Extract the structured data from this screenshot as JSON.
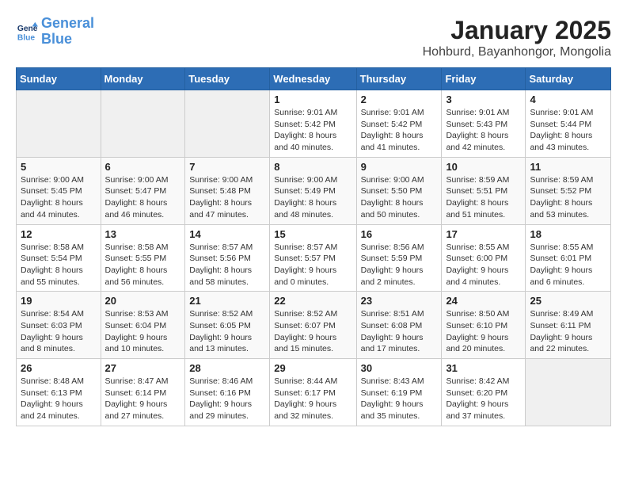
{
  "logo": {
    "line1": "General",
    "line2": "Blue"
  },
  "title": "January 2025",
  "location": "Hohburd, Bayanhongor, Mongolia",
  "days_of_week": [
    "Sunday",
    "Monday",
    "Tuesday",
    "Wednesday",
    "Thursday",
    "Friday",
    "Saturday"
  ],
  "weeks": [
    [
      {
        "day": "",
        "info": ""
      },
      {
        "day": "",
        "info": ""
      },
      {
        "day": "",
        "info": ""
      },
      {
        "day": "1",
        "info": "Sunrise: 9:01 AM\nSunset: 5:42 PM\nDaylight: 8 hours\nand 40 minutes."
      },
      {
        "day": "2",
        "info": "Sunrise: 9:01 AM\nSunset: 5:42 PM\nDaylight: 8 hours\nand 41 minutes."
      },
      {
        "day": "3",
        "info": "Sunrise: 9:01 AM\nSunset: 5:43 PM\nDaylight: 8 hours\nand 42 minutes."
      },
      {
        "day": "4",
        "info": "Sunrise: 9:01 AM\nSunset: 5:44 PM\nDaylight: 8 hours\nand 43 minutes."
      }
    ],
    [
      {
        "day": "5",
        "info": "Sunrise: 9:00 AM\nSunset: 5:45 PM\nDaylight: 8 hours\nand 44 minutes."
      },
      {
        "day": "6",
        "info": "Sunrise: 9:00 AM\nSunset: 5:47 PM\nDaylight: 8 hours\nand 46 minutes."
      },
      {
        "day": "7",
        "info": "Sunrise: 9:00 AM\nSunset: 5:48 PM\nDaylight: 8 hours\nand 47 minutes."
      },
      {
        "day": "8",
        "info": "Sunrise: 9:00 AM\nSunset: 5:49 PM\nDaylight: 8 hours\nand 48 minutes."
      },
      {
        "day": "9",
        "info": "Sunrise: 9:00 AM\nSunset: 5:50 PM\nDaylight: 8 hours\nand 50 minutes."
      },
      {
        "day": "10",
        "info": "Sunrise: 8:59 AM\nSunset: 5:51 PM\nDaylight: 8 hours\nand 51 minutes."
      },
      {
        "day": "11",
        "info": "Sunrise: 8:59 AM\nSunset: 5:52 PM\nDaylight: 8 hours\nand 53 minutes."
      }
    ],
    [
      {
        "day": "12",
        "info": "Sunrise: 8:58 AM\nSunset: 5:54 PM\nDaylight: 8 hours\nand 55 minutes."
      },
      {
        "day": "13",
        "info": "Sunrise: 8:58 AM\nSunset: 5:55 PM\nDaylight: 8 hours\nand 56 minutes."
      },
      {
        "day": "14",
        "info": "Sunrise: 8:57 AM\nSunset: 5:56 PM\nDaylight: 8 hours\nand 58 minutes."
      },
      {
        "day": "15",
        "info": "Sunrise: 8:57 AM\nSunset: 5:57 PM\nDaylight: 9 hours\nand 0 minutes."
      },
      {
        "day": "16",
        "info": "Sunrise: 8:56 AM\nSunset: 5:59 PM\nDaylight: 9 hours\nand 2 minutes."
      },
      {
        "day": "17",
        "info": "Sunrise: 8:55 AM\nSunset: 6:00 PM\nDaylight: 9 hours\nand 4 minutes."
      },
      {
        "day": "18",
        "info": "Sunrise: 8:55 AM\nSunset: 6:01 PM\nDaylight: 9 hours\nand 6 minutes."
      }
    ],
    [
      {
        "day": "19",
        "info": "Sunrise: 8:54 AM\nSunset: 6:03 PM\nDaylight: 9 hours\nand 8 minutes."
      },
      {
        "day": "20",
        "info": "Sunrise: 8:53 AM\nSunset: 6:04 PM\nDaylight: 9 hours\nand 10 minutes."
      },
      {
        "day": "21",
        "info": "Sunrise: 8:52 AM\nSunset: 6:05 PM\nDaylight: 9 hours\nand 13 minutes."
      },
      {
        "day": "22",
        "info": "Sunrise: 8:52 AM\nSunset: 6:07 PM\nDaylight: 9 hours\nand 15 minutes."
      },
      {
        "day": "23",
        "info": "Sunrise: 8:51 AM\nSunset: 6:08 PM\nDaylight: 9 hours\nand 17 minutes."
      },
      {
        "day": "24",
        "info": "Sunrise: 8:50 AM\nSunset: 6:10 PM\nDaylight: 9 hours\nand 20 minutes."
      },
      {
        "day": "25",
        "info": "Sunrise: 8:49 AM\nSunset: 6:11 PM\nDaylight: 9 hours\nand 22 minutes."
      }
    ],
    [
      {
        "day": "26",
        "info": "Sunrise: 8:48 AM\nSunset: 6:13 PM\nDaylight: 9 hours\nand 24 minutes."
      },
      {
        "day": "27",
        "info": "Sunrise: 8:47 AM\nSunset: 6:14 PM\nDaylight: 9 hours\nand 27 minutes."
      },
      {
        "day": "28",
        "info": "Sunrise: 8:46 AM\nSunset: 6:16 PM\nDaylight: 9 hours\nand 29 minutes."
      },
      {
        "day": "29",
        "info": "Sunrise: 8:44 AM\nSunset: 6:17 PM\nDaylight: 9 hours\nand 32 minutes."
      },
      {
        "day": "30",
        "info": "Sunrise: 8:43 AM\nSunset: 6:19 PM\nDaylight: 9 hours\nand 35 minutes."
      },
      {
        "day": "31",
        "info": "Sunrise: 8:42 AM\nSunset: 6:20 PM\nDaylight: 9 hours\nand 37 minutes."
      },
      {
        "day": "",
        "info": ""
      }
    ]
  ]
}
